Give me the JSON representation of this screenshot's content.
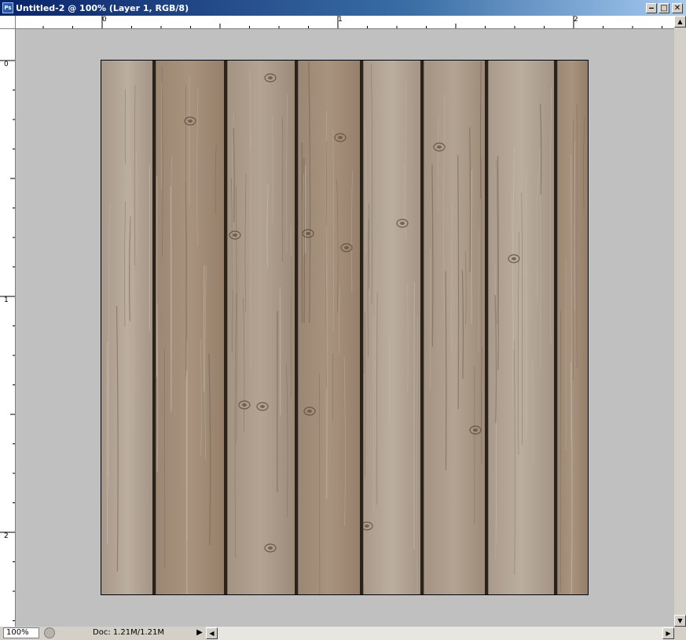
{
  "window": {
    "title": "Untitled-2 @ 100% (Layer 1, RGB/8)",
    "app_icon_text": "Ps",
    "minimize_glyph": "‒",
    "maximize_glyph": "□",
    "close_glyph": "✕"
  },
  "rulers": {
    "horizontal_labels": [
      "0",
      "1",
      "2"
    ],
    "vertical_labels": [
      "0",
      "1",
      "2"
    ]
  },
  "canvas": {
    "image": "weathered-wood-planks",
    "wood_base_color": "#9c8a76",
    "gap_color": "#2a231c",
    "pasteboard_color": "#c0c0c0"
  },
  "status_bar": {
    "zoom": "100%",
    "doc_info": "Doc: 1.21M/1.21M",
    "menu_arrow": "▶"
  },
  "scrollbar_glyphs": {
    "up": "▲",
    "down": "▼",
    "left": "◀",
    "right": "▶"
  }
}
